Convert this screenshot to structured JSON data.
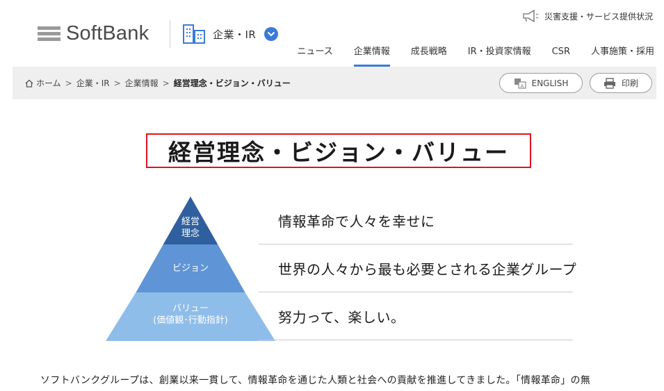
{
  "header": {
    "logo_text": "SoftBank",
    "corp_label": "企業・IR",
    "notice_label": "災害支援・サービス提供状況",
    "nav": [
      {
        "label": "ニュース",
        "active": false
      },
      {
        "label": "企業情報",
        "active": true
      },
      {
        "label": "成長戦略",
        "active": false
      },
      {
        "label": "IR・投資家情報",
        "active": false
      },
      {
        "label": "CSR",
        "active": false
      },
      {
        "label": "人事施策・採用",
        "active": false
      }
    ],
    "accent_color": "#3c7ad9"
  },
  "breadcrumb": {
    "items": [
      "ホーム",
      "企業・IR",
      "企業情報"
    ],
    "current": "経営理念・ビジョン・バリュー",
    "separator": ">"
  },
  "actions": {
    "english_label": "ENGLISH",
    "print_label": "印刷"
  },
  "page": {
    "title": "経営理念・ビジョン・バリュー",
    "title_border_color": "#e0121e"
  },
  "pyramid": {
    "levels": [
      {
        "label_line1": "経営",
        "label_line2": "理念",
        "color": "#2f5f9e",
        "text": "情報革命で人々を幸せに"
      },
      {
        "label_line1": "ビジョン",
        "label_line2": "",
        "color": "#5f95d6",
        "text": "世界の人々から最も必要とされる企業グループ"
      },
      {
        "label_line1": "バリュー",
        "label_line2": "(価値観･行動指針)",
        "color": "#8fbdea",
        "text": "努力って、楽しい。"
      }
    ]
  },
  "body": {
    "intro": "ソフトバンクグループは、創業以来一貫して、情報革命を通じた人類と社会への貢献を推進してきました。「情報革命」の無"
  }
}
